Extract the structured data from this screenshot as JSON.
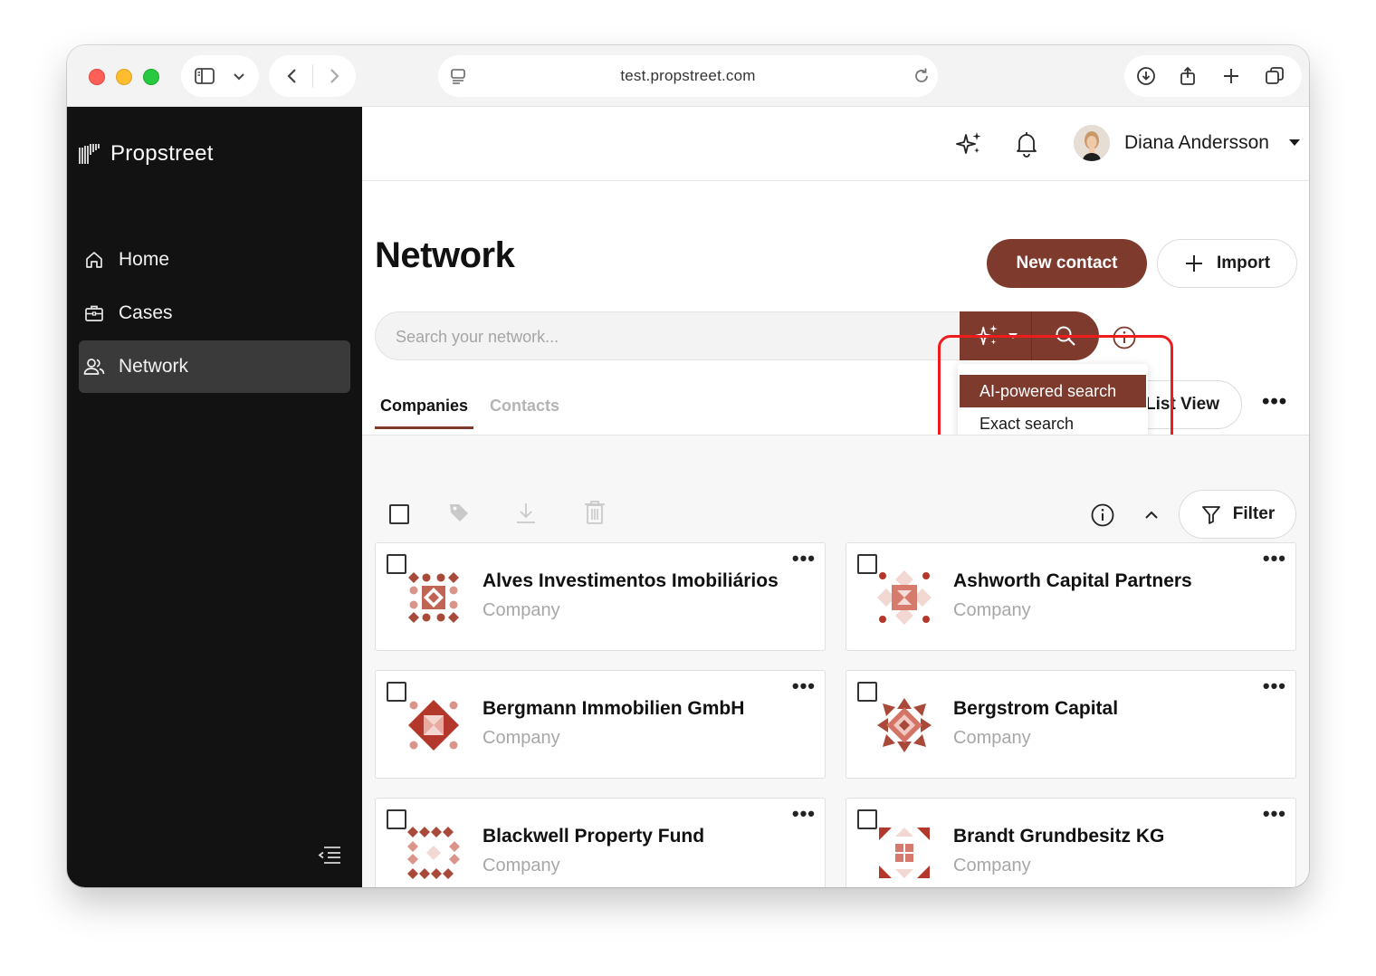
{
  "browser": {
    "url": "test.propstreet.com"
  },
  "sidebar": {
    "brand": "Propstreet",
    "items": [
      {
        "label": "Home",
        "icon": "home-icon"
      },
      {
        "label": "Cases",
        "icon": "briefcase-icon"
      },
      {
        "label": "Network",
        "icon": "users-icon",
        "active": true
      }
    ]
  },
  "topbar": {
    "user_name": "Diana Andersson"
  },
  "page": {
    "title": "Network",
    "new_contact_label": "New contact",
    "import_label": "Import"
  },
  "search": {
    "placeholder": "Search your network...",
    "mode_options": [
      "AI-powered search",
      "Exact search"
    ],
    "selected_mode": "AI-powered search"
  },
  "tabs": [
    {
      "label": "Companies",
      "active": true
    },
    {
      "label": "Contacts",
      "active": false
    }
  ],
  "view_toggle_label": "List View",
  "filter_label": "Filter",
  "companies": [
    {
      "name": "Alves Investimentos Imobiliários",
      "type": "Company"
    },
    {
      "name": "Ashworth Capital Partners",
      "type": "Company"
    },
    {
      "name": "Bergmann Immobilien GmbH",
      "type": "Company"
    },
    {
      "name": "Bergstrom Capital",
      "type": "Company"
    },
    {
      "name": "Blackwell Property Fund",
      "type": "Company"
    },
    {
      "name": "Brandt Grundbesitz KG",
      "type": "Company"
    }
  ],
  "colors": {
    "brand": "#7e3a2d",
    "sidebar_bg": "#121212",
    "highlight": "#ee1c1c"
  }
}
